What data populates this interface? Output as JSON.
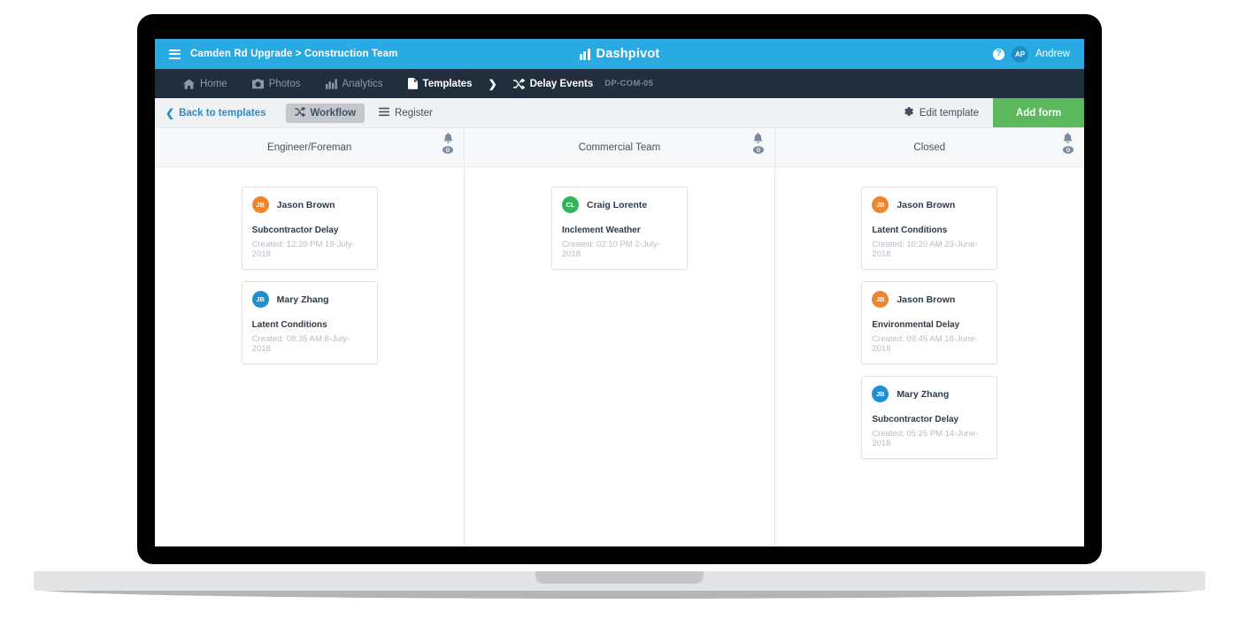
{
  "topbar": {
    "menu_icon": "hamburger-icon",
    "breadcrumb": "Camden Rd Upgrade > Construction Team",
    "brand_name": "Dashpivot",
    "brand_logo_icon": "bar-chart-logo-icon",
    "help_icon": "help-icon",
    "help_label": "?",
    "user_initials": "AP",
    "user_name": "Andrew",
    "bg_color": "#29aae3"
  },
  "navbar": {
    "items": [
      {
        "label": "Home",
        "icon": "home-icon",
        "active": false
      },
      {
        "label": "Photos",
        "icon": "camera-icon",
        "active": false
      },
      {
        "label": "Analytics",
        "icon": "chart-icon",
        "active": false
      },
      {
        "label": "Templates",
        "icon": "document-icon",
        "active": true
      }
    ],
    "chevron_icon": "chevron-right-icon",
    "current_template": "Delay Events",
    "current_template_icon": "shuffle-icon",
    "template_code": "DP-COM-05",
    "bg_color": "#212e3c"
  },
  "toolbar": {
    "back_label": "Back to templates",
    "back_icon": "chevron-left-icon",
    "workflow_label": "Workflow",
    "workflow_icon": "shuffle-icon",
    "workflow_active": true,
    "register_label": "Register",
    "register_icon": "list-icon",
    "edit_template_label": "Edit template",
    "edit_template_icon": "gear-icon",
    "add_form_label": "Add form",
    "add_form_color": "#5cb85c"
  },
  "board": {
    "columns": [
      {
        "title": "Engineer/Foreman",
        "bell_icon": "bell-icon",
        "eye_icon": "eye-icon",
        "cards": [
          {
            "person": "Jason Brown",
            "initials": "JB",
            "avatar_color": "#f0862c",
            "title": "Subcontractor Delay",
            "created": "Created: 12:20 PM 19-July-2018"
          },
          {
            "person": "Mary Zhang",
            "initials": "JB",
            "avatar_color": "#1f8fd4",
            "title": "Latent Conditions",
            "created": "Created: 08:35 AM 8-July-2018"
          }
        ]
      },
      {
        "title": "Commercial Team",
        "bell_icon": "bell-icon",
        "eye_icon": "eye-icon",
        "cards": [
          {
            "person": "Craig Lorente",
            "initials": "CL",
            "avatar_color": "#34b35b",
            "title": "Inclement Weather",
            "created": "Created: 02:10 PM 2-July-2018"
          }
        ]
      },
      {
        "title": "Closed",
        "bell_icon": "bell-icon",
        "eye_icon": "eye-icon",
        "cards": [
          {
            "person": "Jason Brown",
            "initials": "JB",
            "avatar_color": "#f0862c",
            "title": "Latent Conditions",
            "created": "Created: 10:20 AM 23-June-2018"
          },
          {
            "person": "Jason Brown",
            "initials": "JB",
            "avatar_color": "#f0862c",
            "title": "Environmental Delay",
            "created": "Created: 09:45 AM 18-June-2018"
          },
          {
            "person": "Mary Zhang",
            "initials": "JB",
            "avatar_color": "#1f8fd4",
            "title": "Subcontractor Delay",
            "created": "Created: 05:25 PM 14-June-2018"
          }
        ]
      }
    ]
  }
}
